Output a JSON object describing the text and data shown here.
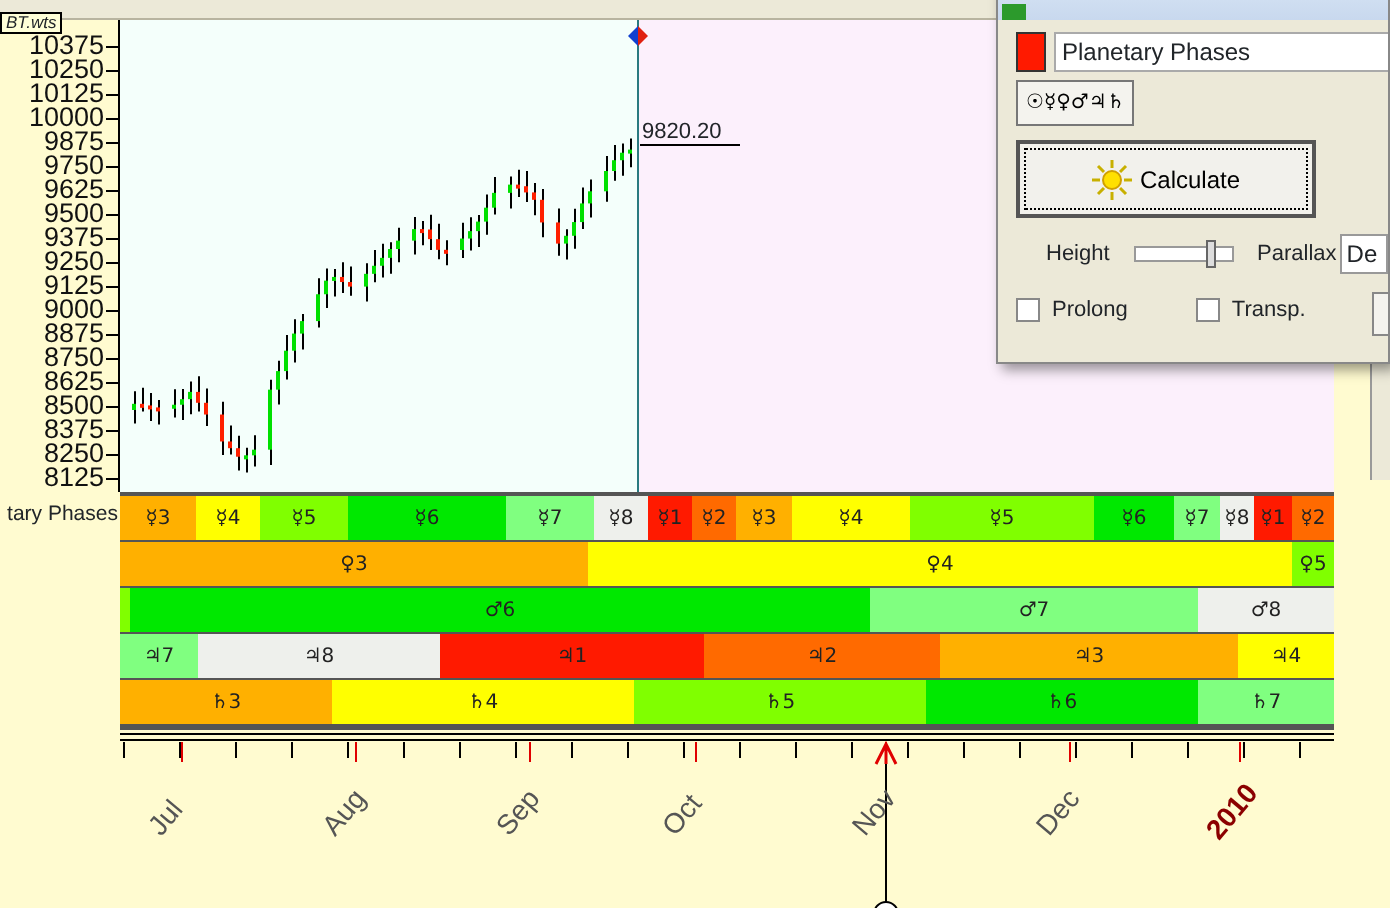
{
  "chart": {
    "file_tag": "BT.wts",
    "y_axis_labels": [
      "10375",
      "10250",
      "10125",
      "10000",
      "9875",
      "9750",
      "9625",
      "9500",
      "9375",
      "9250",
      "9125",
      "9000",
      "8875",
      "8750",
      "8625",
      "8500",
      "8375",
      "8250",
      "8125"
    ],
    "last_price": "9820.20"
  },
  "indicator": {
    "label": "tary Phases",
    "rows": [
      {
        "segments": [
          {
            "text": "☿3",
            "color": "#ffb000"
          },
          {
            "text": "☿4",
            "color": "#ffff00"
          },
          {
            "text": "☿5",
            "color": "#80ff00"
          },
          {
            "text": "☿6",
            "color": "#00e800"
          },
          {
            "text": "☿7",
            "color": "#80ff80"
          },
          {
            "text": "☿8",
            "color": "#eef0ec"
          },
          {
            "text": "☿1",
            "color": "#ff1a00"
          },
          {
            "text": "☿2",
            "color": "#ff6a00"
          },
          {
            "text": "☿3",
            "color": "#ffb000"
          },
          {
            "text": "☿4",
            "color": "#ffff00"
          },
          {
            "text": "☿5",
            "color": "#80ff00"
          },
          {
            "text": "☿6",
            "color": "#00e800"
          },
          {
            "text": "☿7",
            "color": "#80ff80"
          },
          {
            "text": "☿8",
            "color": "#eef0ec"
          },
          {
            "text": "☿1",
            "color": "#ff1a00"
          },
          {
            "text": "☿2",
            "color": "#ff6a00"
          }
        ]
      },
      {
        "segments": [
          {
            "text": "♀3",
            "color": "#ffb000"
          },
          {
            "text": "♀4",
            "color": "#ffff00"
          },
          {
            "text": "♀5",
            "color": "#80ff00"
          }
        ]
      },
      {
        "segments": [
          {
            "color": "#80ff00"
          },
          {
            "text": "♂6",
            "color": "#00e800"
          },
          {
            "text": "♂7",
            "color": "#80ff80"
          },
          {
            "text": "♂8",
            "color": "#eef0ec"
          }
        ]
      },
      {
        "segments": [
          {
            "text": "♃7",
            "color": "#80ff80"
          },
          {
            "text": "♃8",
            "color": "#eef0ec"
          },
          {
            "text": "♃1",
            "color": "#ff1a00"
          },
          {
            "text": "♃2",
            "color": "#ff6a00"
          },
          {
            "text": "♃3",
            "color": "#ffb000"
          },
          {
            "text": "♃4",
            "color": "#ffff00"
          }
        ]
      },
      {
        "segments": [
          {
            "text": "♄3",
            "color": "#ffb000"
          },
          {
            "text": "♄4",
            "color": "#ffff00"
          },
          {
            "text": "♄5",
            "color": "#80ff00"
          },
          {
            "text": "♄6",
            "color": "#00e800"
          },
          {
            "text": "♄7",
            "color": "#80ff80"
          }
        ]
      }
    ]
  },
  "time_axis": {
    "labels": [
      {
        "text": "Jul",
        "kind": "month"
      },
      {
        "text": "Aug",
        "kind": "month"
      },
      {
        "text": "Sep",
        "kind": "month"
      },
      {
        "text": "Oct",
        "kind": "month"
      },
      {
        "text": "Nov",
        "kind": "month"
      },
      {
        "text": "Dec",
        "kind": "month"
      },
      {
        "text": "2010",
        "kind": "year"
      }
    ]
  },
  "dialog": {
    "color": "#ff1a00",
    "name_value": "Planetary Phases",
    "planets_button": "☉☿♀♂♃♄",
    "calculate_button": "Calculate",
    "height_label": "Height",
    "height": {
      "level": 0.8
    },
    "parallax_label": "Parallax",
    "parallax_value": "De",
    "options": [
      {
        "label": "Prolong",
        "checked": false
      },
      {
        "label": "Transp.",
        "checked": false
      }
    ]
  }
}
